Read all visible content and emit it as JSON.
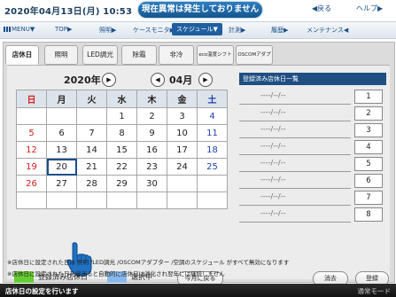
{
  "header": {
    "datetime": "2020年04月13日(月) 10:53",
    "status": "現在異常は発生しておりません",
    "back_label": "◀戻る",
    "help_label": "ヘルプ▶"
  },
  "nav": {
    "items": [
      "MENU▼",
      "TOP▶",
      "照明▶",
      "ケースモニタ▶",
      "スケジュール▼",
      "計測▶",
      "履歴▶",
      "メンテナンス◀"
    ],
    "active_index": 4
  },
  "tabs": [
    "店休日",
    "照明",
    "LED調光",
    "除霜",
    "非冷",
    "eco温度シフト",
    "OSCOMアダプタ"
  ],
  "calendar": {
    "year_label": "2020年",
    "month_label": "04月",
    "prev_symbol": "◀",
    "next_symbol": "▶",
    "weekdays": [
      "日",
      "月",
      "火",
      "水",
      "木",
      "金",
      "土"
    ],
    "weeks": [
      [
        "",
        "",
        "",
        "1",
        "2",
        "3",
        "4"
      ],
      [
        "5",
        "6",
        "7",
        "8",
        "9",
        "10",
        "11"
      ],
      [
        "12",
        "13",
        "14",
        "15",
        "16",
        "17",
        "18"
      ],
      [
        "19",
        "20",
        "21",
        "22",
        "23",
        "24",
        "25"
      ],
      [
        "26",
        "27",
        "28",
        "29",
        "30",
        "",
        ""
      ],
      [
        "",
        "",
        "",
        "",
        "",
        "",
        ""
      ]
    ],
    "selected_day": "20"
  },
  "list": {
    "header": "登録済み店休日一覧",
    "rows": [
      {
        "date": "----/--/--",
        "num": "1"
      },
      {
        "date": "----/--/--",
        "num": "2"
      },
      {
        "date": "----/--/--",
        "num": "3"
      },
      {
        "date": "----/--/--",
        "num": "4"
      },
      {
        "date": "----/--/--",
        "num": "5"
      },
      {
        "date": "----/--/--",
        "num": "6"
      },
      {
        "date": "----/--/--",
        "num": "7"
      },
      {
        "date": "----/--/--",
        "num": "8"
      }
    ]
  },
  "legend": {
    "registered_label": "登録済み店休日",
    "registered_color": "#66cc33",
    "selected_label": "選択中",
    "selected_color": "#88b8ec"
  },
  "buttons": {
    "today": "今月に戻る",
    "delete": "消去",
    "register": "登録"
  },
  "notes": [
    "※店休日に設定された日は 照明 /LED調光 /OSCOMアダプター /空調のスケジュール がすべて無効になります",
    "※店休日に設定された日を過ぎると自動的に店休日は消化され翌年には継続しません"
  ],
  "footer": {
    "left": "店休日の設定を行います",
    "right": "通常モード"
  }
}
